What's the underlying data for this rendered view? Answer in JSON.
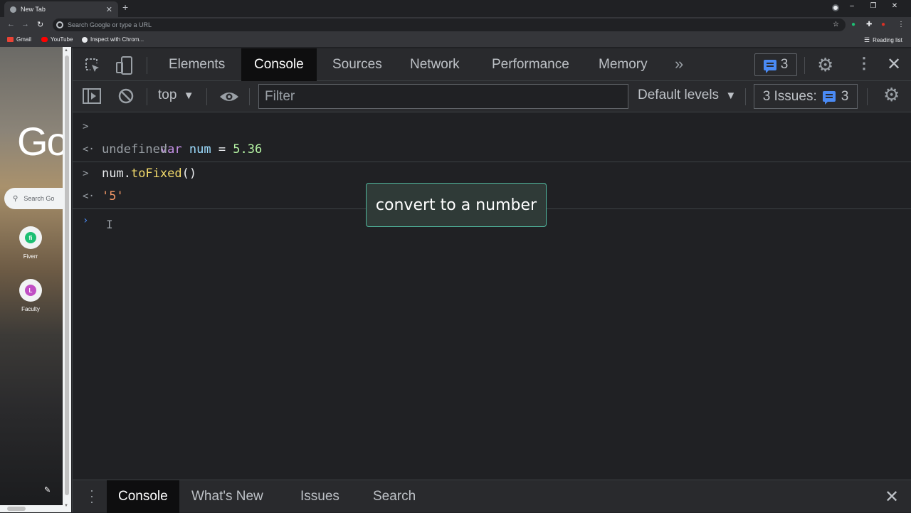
{
  "browser": {
    "tab_title": "New Tab",
    "omnibox_placeholder": "Search Google or type a URL",
    "bookmarks": [
      "Gmail",
      "YouTube",
      "Inspect with Chrom..."
    ],
    "reading_list": "Reading list"
  },
  "newtab": {
    "logo": "Go",
    "search_placeholder": "Search Go",
    "shortcuts": [
      {
        "label": "Fiverr",
        "letter": "fi",
        "color": "#1dbf73"
      },
      {
        "label": "Faculty",
        "letter": "L",
        "color": "#c04fc4"
      }
    ]
  },
  "devtools": {
    "tabs": [
      "Elements",
      "Console",
      "Sources",
      "Network",
      "Performance",
      "Memory"
    ],
    "active_tab": "Console",
    "message_count": "3",
    "context": "top",
    "filter_placeholder": "Filter",
    "levels": "Default levels",
    "issues_label": "3 Issues:",
    "issues_count": "3"
  },
  "console": {
    "lines": [
      {
        "gutter": ">",
        "tokens": [
          [
            "kw",
            "var"
          ],
          [
            "plain",
            " "
          ],
          [
            "var",
            "num"
          ],
          [
            "plain",
            " = "
          ],
          [
            "num",
            "5.36"
          ]
        ]
      },
      {
        "gutter": "<·",
        "tokens": [
          [
            "muted",
            "undefined"
          ]
        ]
      },
      {
        "gutter": ">",
        "tokens": [
          [
            "plain",
            "num."
          ],
          [
            "meth",
            "toFixed"
          ],
          [
            "plain",
            "()"
          ]
        ]
      },
      {
        "gutter": "<·",
        "tokens": [
          [
            "str",
            "'5'"
          ]
        ]
      }
    ]
  },
  "tooltip": "convert to a number",
  "drawer": {
    "tabs": [
      "Console",
      "What's New",
      "Issues",
      "Search"
    ],
    "active_tab": "Console"
  },
  "colors": {
    "accent": "#4a8af4",
    "tooltip_border": "#4fb49c",
    "panel_bg": "#292a2d",
    "console_bg": "#202124"
  }
}
